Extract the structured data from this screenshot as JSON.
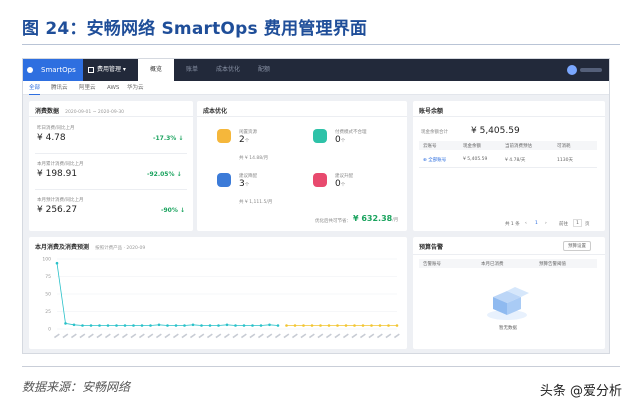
{
  "figure": {
    "title": "图 24：安畅网络 SmartOps 费用管理界面",
    "source": "数据来源：安畅网络",
    "watermark": "头条 @爱分析"
  },
  "app": {
    "brand": "SmartOps",
    "menu_label": "费用管理",
    "top_tabs": [
      "概览",
      "账单",
      "成本优化",
      "配额"
    ],
    "active_top_tab": 0,
    "sub_tabs": [
      "全部",
      "腾讯云",
      "阿里云",
      "AWS",
      "华为云"
    ],
    "active_sub_tab": 0
  },
  "consumption": {
    "title": "消费数据",
    "date_range": "2020-09-01 ~ 2020-09-30",
    "rows": [
      {
        "label": "昨日消费/同比上月",
        "value": "¥ 4.78",
        "pct": "-17.3%"
      },
      {
        "label": "本月累计消费/同比上月",
        "value": "¥ 198.91",
        "pct": "-92.05%"
      },
      {
        "label": "本月预计消费/同比上月",
        "value": "¥ 256.27",
        "pct": "-90%"
      }
    ]
  },
  "optimize": {
    "title": "成本优化",
    "tiles": [
      {
        "label": "闲置资源",
        "value": "2",
        "unit": "个",
        "sub": "共 ¥ 14.88/月",
        "color": "#f5b73b",
        "icon": "box-icon"
      },
      {
        "label": "付费模式不合理",
        "value": "0",
        "unit": "个",
        "sub": "",
        "color": "#2ec2a8",
        "icon": "money-bag-icon"
      },
      {
        "label": "建议降配",
        "value": "3",
        "unit": "个",
        "sub": "共 ¥ 1,111.5/月",
        "color": "#3c7bd8",
        "icon": "down-gauge-icon"
      },
      {
        "label": "建议升配",
        "value": "0",
        "unit": "个",
        "sub": "",
        "color": "#e84a6e",
        "icon": "up-gauge-icon"
      }
    ],
    "saving_label": "优化后共可节省：",
    "saving_value": "¥ 632.38",
    "saving_unit": "/月"
  },
  "balance": {
    "title": "账号余额",
    "total_label": "现金余额合计",
    "total_value": "¥ 5,405.59",
    "columns": [
      "云账号",
      "现金余额",
      "当前消费预估",
      "可消耗"
    ],
    "rows": [
      [
        "全部账号",
        "¥ 5,405.59",
        "¥ 4.78/天",
        "1130天"
      ]
    ],
    "pager": {
      "total": "共 1 条",
      "page": "1",
      "goto_label": "前往",
      "goto_page": "1",
      "page_unit": "页"
    }
  },
  "trend": {
    "title": "本月消费及消费预测",
    "subtitle": "按照计费产品 · 2020-09",
    "y_ticks": [
      "100",
      "75",
      "50",
      "25",
      "0"
    ]
  },
  "alerts": {
    "title": "预算告警",
    "settings_label": "预算设置",
    "columns": [
      "告警账号",
      "本月已消费",
      "预算告警阈值"
    ],
    "empty_text": "暂无数据"
  },
  "chart_data": {
    "type": "line",
    "ylim": [
      0,
      100
    ],
    "series": [
      {
        "values": [
          94,
          8,
          6,
          5,
          5,
          5,
          5,
          5,
          5,
          5,
          5,
          5,
          6,
          5,
          5,
          5,
          6,
          5,
          5,
          5,
          6,
          5,
          5,
          5,
          5,
          6,
          5
        ],
        "color": "#29c1c9"
      },
      {
        "values": [
          5,
          5,
          5,
          5,
          5,
          5,
          5,
          5,
          5,
          5,
          5,
          5,
          5,
          5
        ],
        "color": "#f2c531"
      }
    ],
    "forecast_start_index": 20
  }
}
